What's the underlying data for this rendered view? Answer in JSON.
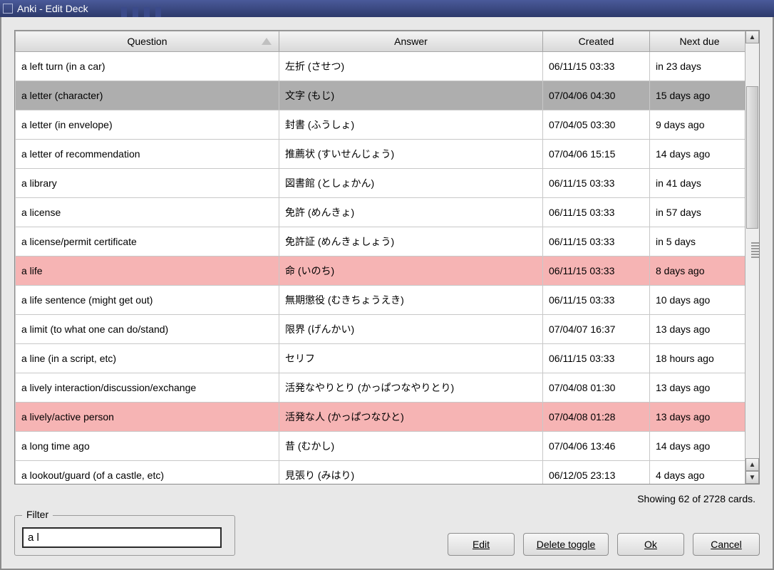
{
  "window": {
    "title": "Anki - Edit Deck"
  },
  "columns": {
    "question": "Question",
    "answer": "Answer",
    "created": "Created",
    "nextdue": "Next due"
  },
  "rows": [
    {
      "q": "a left turn (in a car)",
      "a": "左折 (させつ)",
      "c": "06/11/15 03:33",
      "d": "in 23 days",
      "state": ""
    },
    {
      "q": "a letter (character)",
      "a": "文字 (もじ)",
      "c": "07/04/06 04:30",
      "d": "15 days ago",
      "state": "selected"
    },
    {
      "q": "a letter (in envelope)",
      "a": "封書 (ふうしょ)",
      "c": "07/04/05 03:30",
      "d": "9 days ago",
      "state": ""
    },
    {
      "q": "a letter of recommendation",
      "a": "推薦状 (すいせんじょう)",
      "c": "07/04/06 15:15",
      "d": "14 days ago",
      "state": ""
    },
    {
      "q": "a library",
      "a": "図書館 (としょかん)",
      "c": "06/11/15 03:33",
      "d": "in 41 days",
      "state": ""
    },
    {
      "q": "a license",
      "a": "免許 (めんきょ)",
      "c": "06/11/15 03:33",
      "d": "in 57 days",
      "state": ""
    },
    {
      "q": "a license/permit certificate",
      "a": "免許証 (めんきょしょう)",
      "c": "06/11/15 03:33",
      "d": "in 5 days",
      "state": ""
    },
    {
      "q": "a life",
      "a": "命 (いのち)",
      "c": "06/11/15 03:33",
      "d": "8 days ago",
      "state": "pink"
    },
    {
      "q": "a life sentence (might get out)",
      "a": "無期懲役 (むきちょうえき)",
      "c": "06/11/15 03:33",
      "d": "10 days ago",
      "state": ""
    },
    {
      "q": "a limit (to what one can do/stand)",
      "a": "限界 (げんかい)",
      "c": "07/04/07 16:37",
      "d": "13 days ago",
      "state": ""
    },
    {
      "q": "a line (in a script, etc)",
      "a": "セリフ",
      "c": "06/11/15 03:33",
      "d": "18 hours ago",
      "state": ""
    },
    {
      "q": "a lively interaction/discussion/exchange",
      "a": "活発なやりとり (かっぱつなやりとり)",
      "c": "07/04/08 01:30",
      "d": "13 days ago",
      "state": ""
    },
    {
      "q": "a lively/active person",
      "a": "活発な人 (かっぱつなひと)",
      "c": "07/04/08 01:28",
      "d": "13 days ago",
      "state": "pink"
    },
    {
      "q": "a long time ago",
      "a": "昔 (むかし)",
      "c": "07/04/06 13:46",
      "d": "14 days ago",
      "state": ""
    },
    {
      "q": "a lookout/guard (of a castle, etc)",
      "a": "見張り (みはり)",
      "c": "06/12/05 23:13",
      "d": "4 days ago",
      "state": ""
    }
  ],
  "filter": {
    "label": "Filter",
    "value": "a l"
  },
  "status": "Showing 62 of 2728 cards.",
  "buttons": {
    "edit": "Edit",
    "delete": "Delete toggle",
    "ok": "Ok",
    "cancel": "Cancel"
  }
}
